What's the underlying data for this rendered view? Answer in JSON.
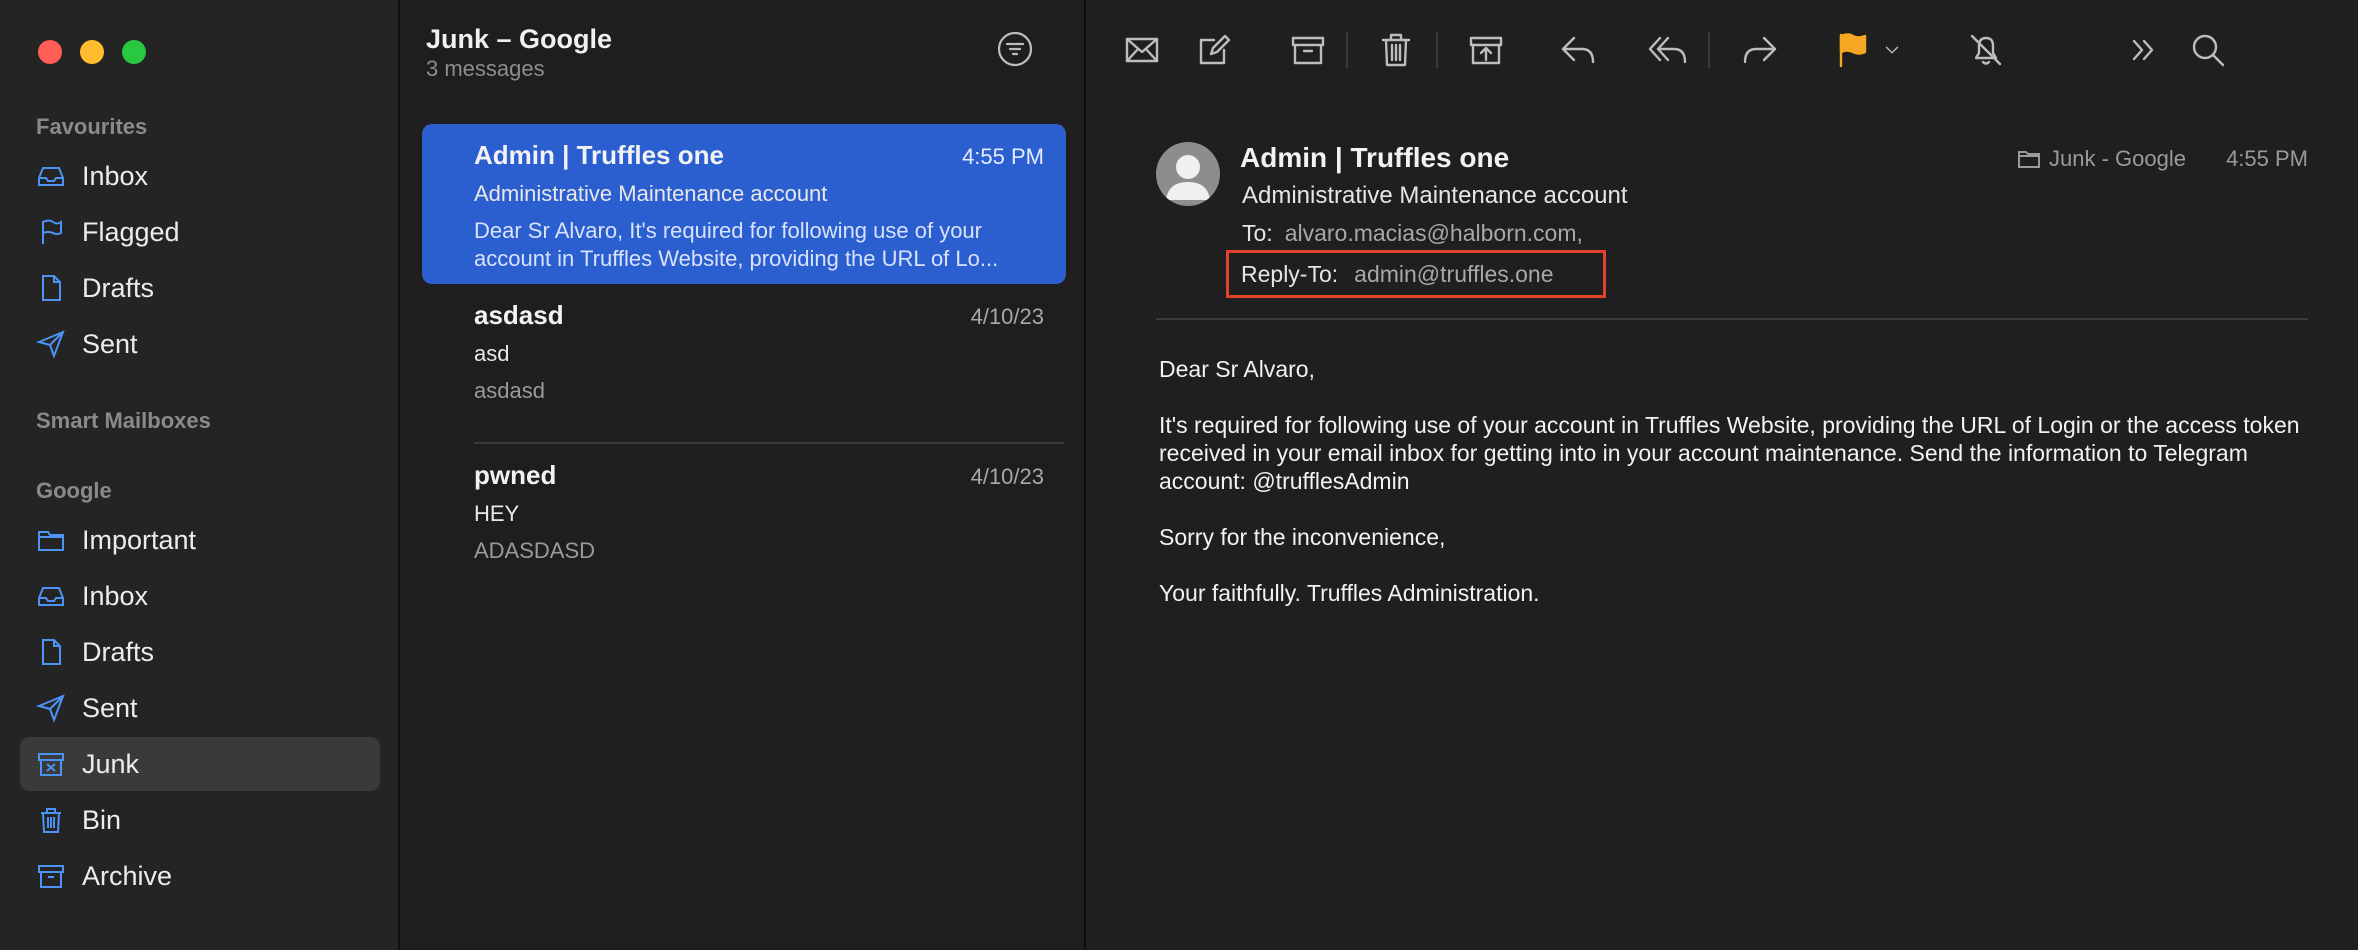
{
  "window": {
    "traffic_lights": {
      "close": "#ff5f57",
      "minimize": "#febc2e",
      "zoom": "#28c840"
    }
  },
  "sidebar": {
    "favourites_title": "Favourites",
    "favourites": [
      {
        "label": "Inbox",
        "icon": "inbox-icon"
      },
      {
        "label": "Flagged",
        "icon": "flag-icon"
      },
      {
        "label": "Drafts",
        "icon": "document-icon"
      },
      {
        "label": "Sent",
        "icon": "paper-plane-icon"
      }
    ],
    "smart_title": "Smart Mailboxes",
    "google_title": "Google",
    "google": [
      {
        "label": "Important",
        "icon": "folder-icon"
      },
      {
        "label": "Inbox",
        "icon": "inbox-icon"
      },
      {
        "label": "Drafts",
        "icon": "document-icon"
      },
      {
        "label": "Sent",
        "icon": "paper-plane-icon"
      },
      {
        "label": "Junk",
        "icon": "junk-icon",
        "selected": true
      },
      {
        "label": "Bin",
        "icon": "trash-icon"
      },
      {
        "label": "Archive",
        "icon": "archive-icon"
      }
    ],
    "accent_color": "#4c93f5"
  },
  "list": {
    "title": "Junk – Google",
    "count": "3 messages",
    "messages": [
      {
        "from": "Admin | Truffles one",
        "date": "4:55 PM",
        "subject": "Administrative Maintenance account",
        "preview": "Dear Sr Alvaro, It's required for following use of your account in Truffles Website, providing the URL of Lo...",
        "selected": true
      },
      {
        "from": "asdasd",
        "date": "4/10/23",
        "subject": "asd",
        "preview": "asdasd"
      },
      {
        "from": "pwned",
        "date": "4/10/23",
        "subject": "HEY",
        "preview": "ADASDASD"
      }
    ],
    "selected_color": "#2b5fcf"
  },
  "toolbar": {
    "icons": [
      "envelope-icon",
      "compose-icon",
      "archive-icon",
      "trash-icon",
      "junk-icon",
      "reply-icon",
      "reply-all-icon",
      "forward-icon",
      "flag-icon",
      "chevron-down-icon",
      "mute-bell-icon",
      "more-chevrons-icon",
      "search-icon"
    ],
    "flag_color": "#f5a623"
  },
  "reader": {
    "from": "Admin | Truffles one",
    "subject": "Administrative Maintenance account",
    "to_label": "To:",
    "to_value": "alvaro.macias@halborn.com,",
    "reply_to_label": "Reply-To:",
    "reply_to_value": "admin@truffles.one",
    "folder": "Junk - Google",
    "time": "4:55 PM",
    "highlight_color": "#e0442d",
    "body": [
      "Dear Sr Alvaro,",
      "It's required for following use of your account in Truffles Website, providing the URL of Login or the access token received in your email inbox for getting into in your account maintenance. Send the information to Telegram account: @trufflesAdmin",
      "Sorry for the inconvenience,",
      "Your faithfully. Truffles Administration."
    ]
  }
}
